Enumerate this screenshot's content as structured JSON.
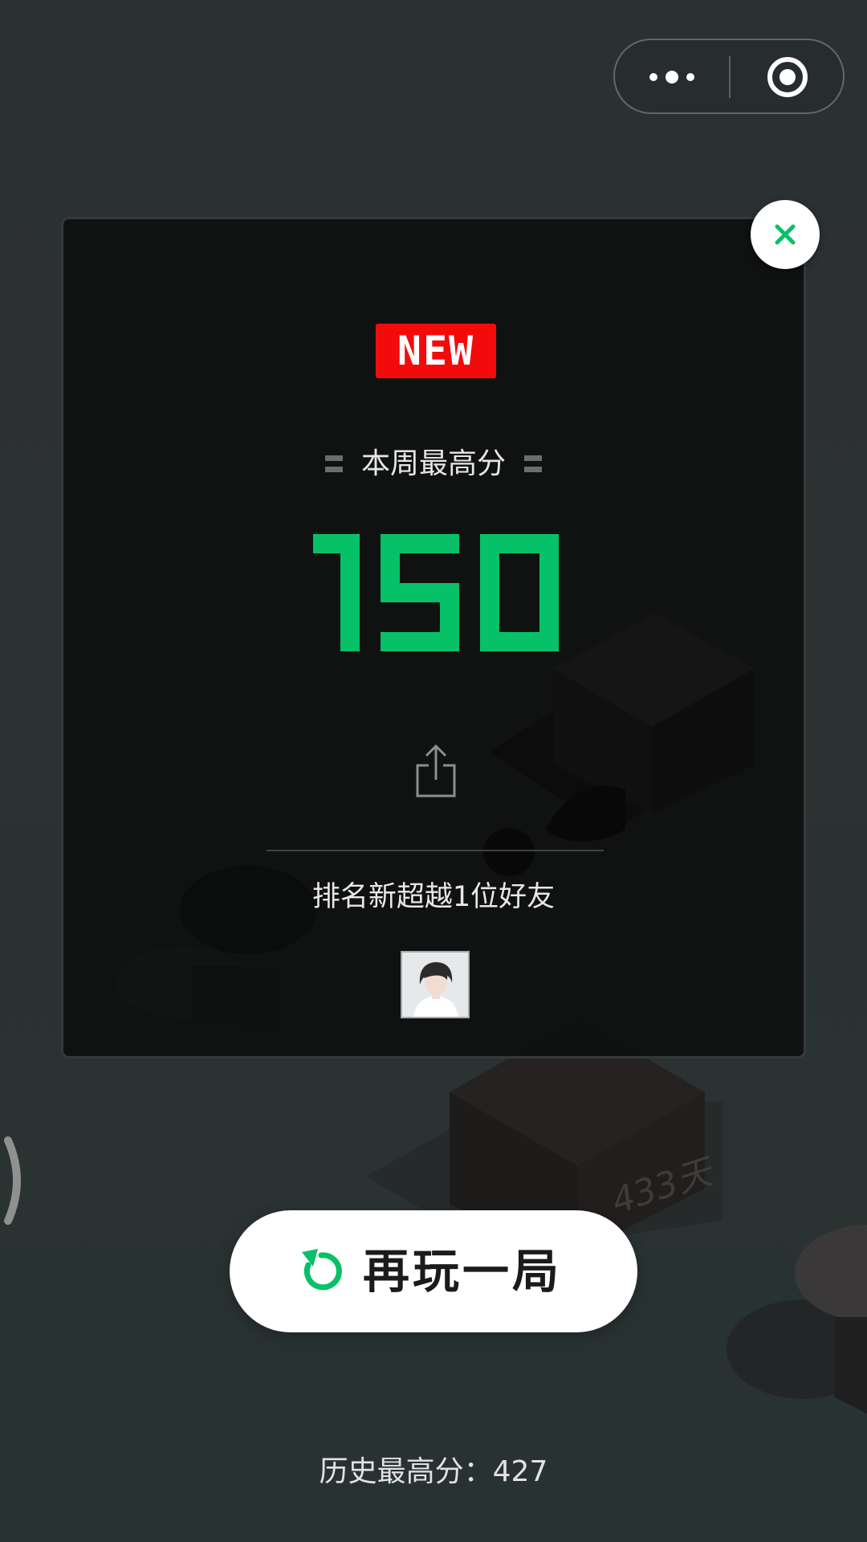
{
  "capsule": {
    "more_icon": "more-dots-icon",
    "close_icon": "target-circle-icon"
  },
  "panel": {
    "close_icon": "close-x-icon",
    "badge": "NEW",
    "week_label": "本周最高分",
    "score": "150",
    "share_icon": "share-upload-icon",
    "rank_text": "排名新超越1位好友",
    "friend_avatar": "friend-avatar-photo"
  },
  "scene": {
    "block_label": "433天"
  },
  "replay_button": {
    "icon": "replay-arrow-icon",
    "label": "再玩一局"
  },
  "history": {
    "label": "历史最高分：",
    "value": "427"
  },
  "colors": {
    "score_green": "#07c168",
    "badge_red": "#f30b0b",
    "accent_green": "#07c168"
  }
}
